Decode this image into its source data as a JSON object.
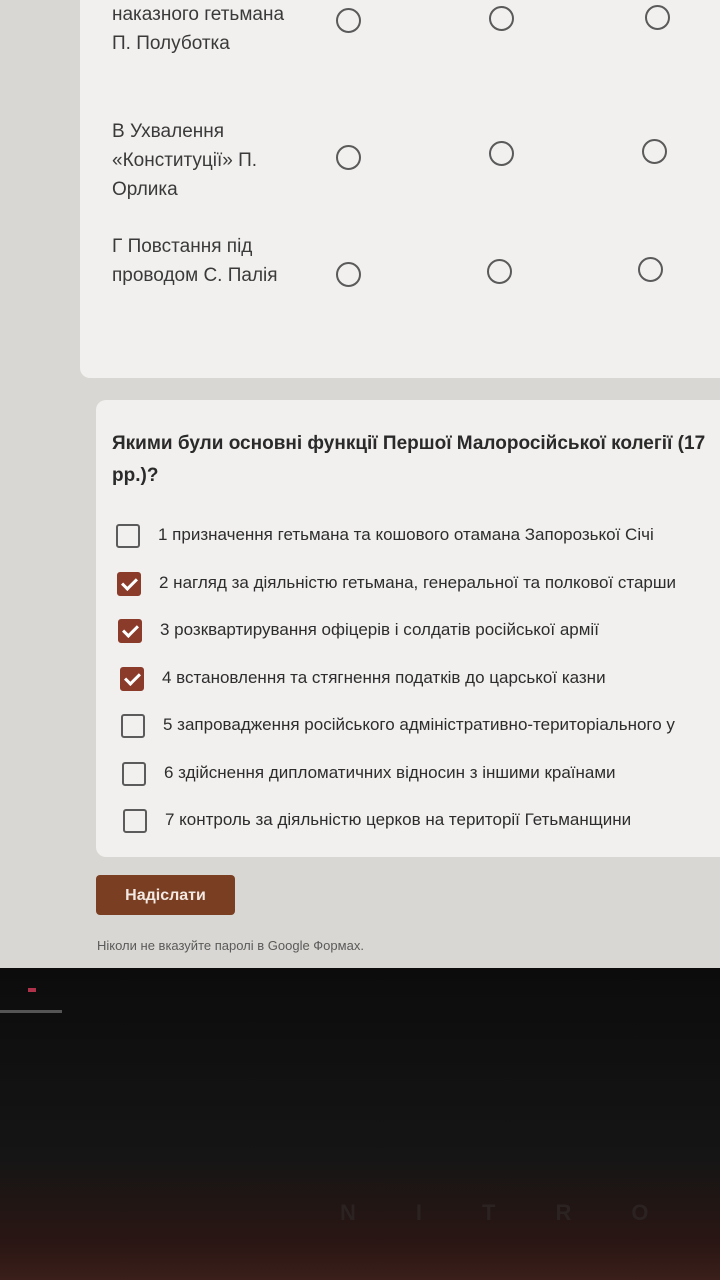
{
  "grid_question": {
    "rows": [
      {
        "label": "наказного гетьмана П. Полуботка"
      },
      {
        "label": "В Ухвалення «Конституції» П. Орлика"
      },
      {
        "label": "Г Повстання під проводом С. Палія"
      }
    ],
    "selected": [
      null,
      null,
      null
    ]
  },
  "checkbox_question": {
    "title_line1": "Якими були основні функції Першої Малоросійської колегії (17",
    "title_line2": "рр.)?",
    "options": [
      {
        "label": "1 призначення гетьмана та кошового отамана Запорозької Січі",
        "checked": false
      },
      {
        "label": "2 нагляд за діяльністю гетьмана, генеральної та полкової старши",
        "checked": true
      },
      {
        "label": "3 розквартирування офіцерів і солдатів російської армії",
        "checked": true
      },
      {
        "label": "4 встановлення та стягнення податків до царської казни",
        "checked": true
      },
      {
        "label": "5 запровадження російського адміністративно-територіального у",
        "checked": false
      },
      {
        "label": "6 здійснення дипломатичних відносин з іншими країнами",
        "checked": false
      },
      {
        "label": "7 контроль за діяльністю церков на території Гетьманщини",
        "checked": false
      }
    ]
  },
  "submit_label": "Надіслати",
  "footer_note": "Ніколи не вказуйте паролі в Google Формах.",
  "device_brand": "NITRO",
  "colors": {
    "accent": "#7a3e22",
    "checkbox_checked": "#8a3b2a",
    "page_bg": "#d9d7d3",
    "card_bg": "#f1f0ee"
  }
}
